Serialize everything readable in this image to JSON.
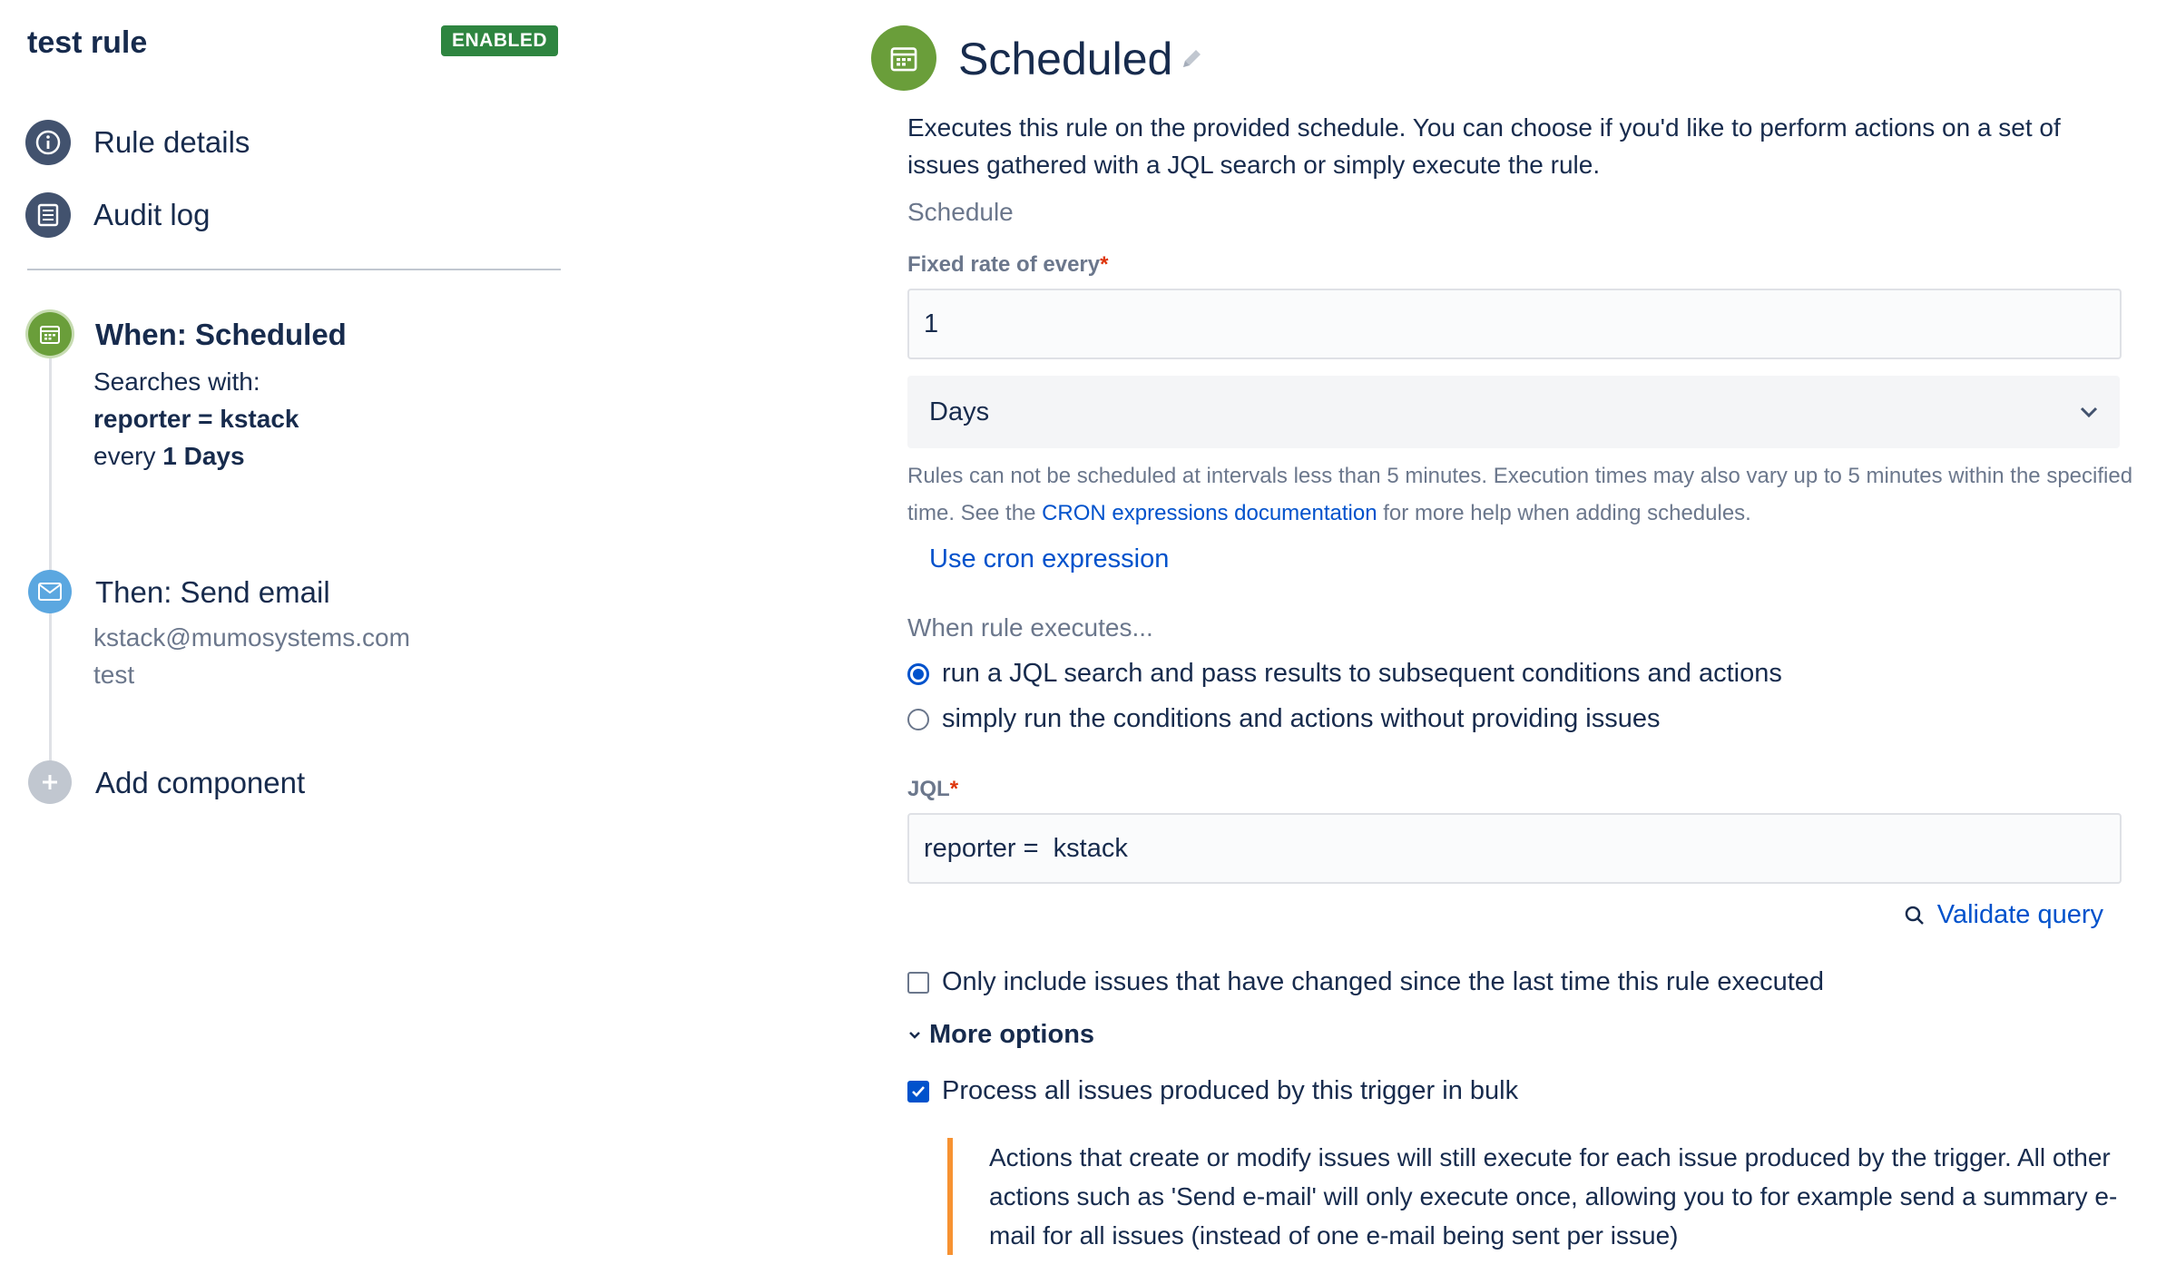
{
  "sidebar": {
    "rule_title": "test rule",
    "status_badge": "ENABLED",
    "nav": [
      {
        "label": "Rule details",
        "icon": "info-icon"
      },
      {
        "label": "Audit log",
        "icon": "list-icon"
      }
    ],
    "components": {
      "trigger": {
        "title": "When: Scheduled",
        "line1": "Searches with:",
        "jql": "reporter = kstack",
        "every_prefix": "every",
        "every_value": "1 Days",
        "icon": "calendar-icon",
        "color": "#6a9e3a"
      },
      "action": {
        "title": "Then: Send email",
        "to": "kstack@mumosystems.com",
        "subject": "test",
        "icon": "mail-icon",
        "color": "#5ba7e0"
      },
      "add": {
        "label": "Add component",
        "icon": "plus-icon"
      }
    }
  },
  "main": {
    "title": "Scheduled",
    "description": "Executes this rule on the provided schedule. You can choose if you'd like to perform actions on a set of issues gathered with a JQL search or simply execute the rule.",
    "schedule_label": "Schedule",
    "fixed_rate": {
      "label": "Fixed rate of every",
      "required_mark": "*",
      "value": "1"
    },
    "unit_select": {
      "value": "Days"
    },
    "help": {
      "before": "Rules can not be scheduled at intervals less than 5 minutes. Execution times may also vary up to 5 minutes within the specified time. See the ",
      "link": "CRON expressions documentation",
      "after": " for more help when adding schedules."
    },
    "cron_link": "Use cron expression",
    "when_label": "When rule executes...",
    "radios": [
      {
        "label": "run a JQL search and pass results to subsequent conditions and actions",
        "selected": true
      },
      {
        "label": "simply run the conditions and actions without providing issues",
        "selected": false
      }
    ],
    "jql": {
      "label": "JQL",
      "required_mark": "*",
      "value": "reporter =  kstack"
    },
    "validate_link": "Validate query",
    "only_changed": {
      "label": "Only include issues that have changed since the last time this rule executed",
      "checked": false
    },
    "more_options": "More options",
    "bulk": {
      "label": "Process all issues produced by this trigger in bulk",
      "checked": true
    },
    "bulk_note": "Actions that create or modify issues will still execute for each issue produced by the trigger. All other actions such as 'Send e-mail' will only execute once, allowing you to for example send a summary e-mail for all issues (instead of one e-mail being sent per issue)"
  }
}
